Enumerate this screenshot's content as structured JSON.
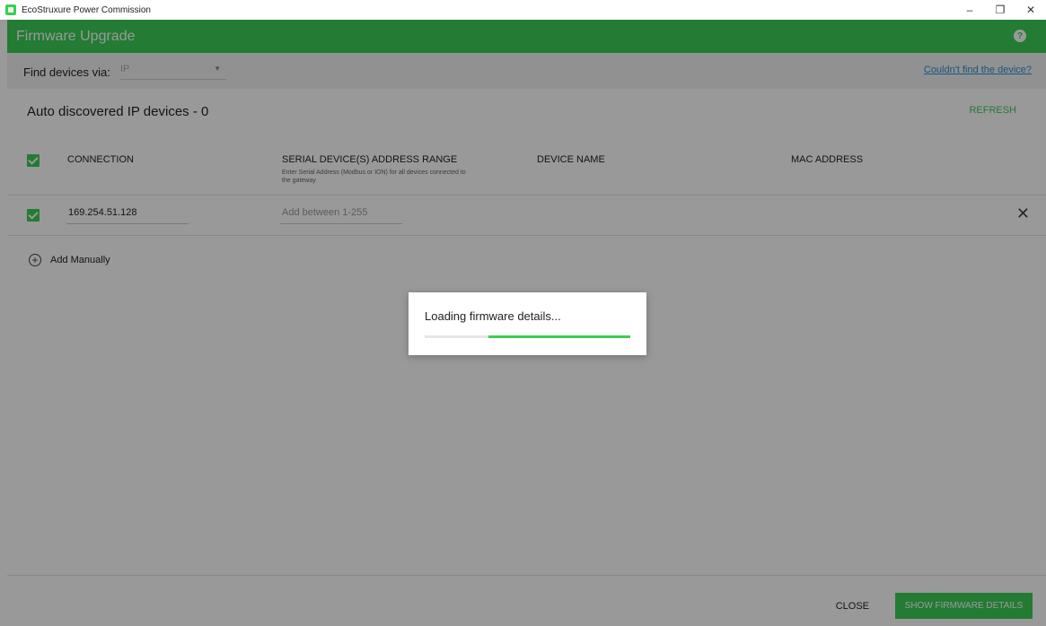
{
  "window": {
    "title": "EcoStruxure Power Commission",
    "minimize": "–",
    "restore": "❐",
    "close": "✕"
  },
  "header": {
    "title": "Firmware Upgrade",
    "help_icon": "question-circle-icon",
    "help_glyph": "?"
  },
  "find": {
    "label": "Find devices via:",
    "selected": "IP",
    "link": "Couldn't find the device?"
  },
  "section": {
    "title": "Auto discovered IP devices - 0",
    "refresh": "REFRESH"
  },
  "columns": {
    "connection": "CONNECTION",
    "serial_range": "SERIAL DEVICE(S) ADDRESS RANGE",
    "serial_range_help": "Enter Serial Address (Modbus or ION) for all devices connected to the gateway",
    "device_name": "DEVICE NAME",
    "mac_address": "MAC ADDRESS"
  },
  "rows": [
    {
      "connection": "169.254.51.128",
      "address_placeholder": "Add between 1-255",
      "checked": true
    }
  ],
  "add_manually": "Add Manually",
  "footer": {
    "close": "CLOSE",
    "show_firmware": "SHOW FIRMWARE DETAILS"
  },
  "dialog": {
    "message": "Loading firmware details...",
    "progress_start": 0.31,
    "progress_end": 1.0
  },
  "colors": {
    "brand": "#3dcd58",
    "link": "#2d8fd6"
  }
}
